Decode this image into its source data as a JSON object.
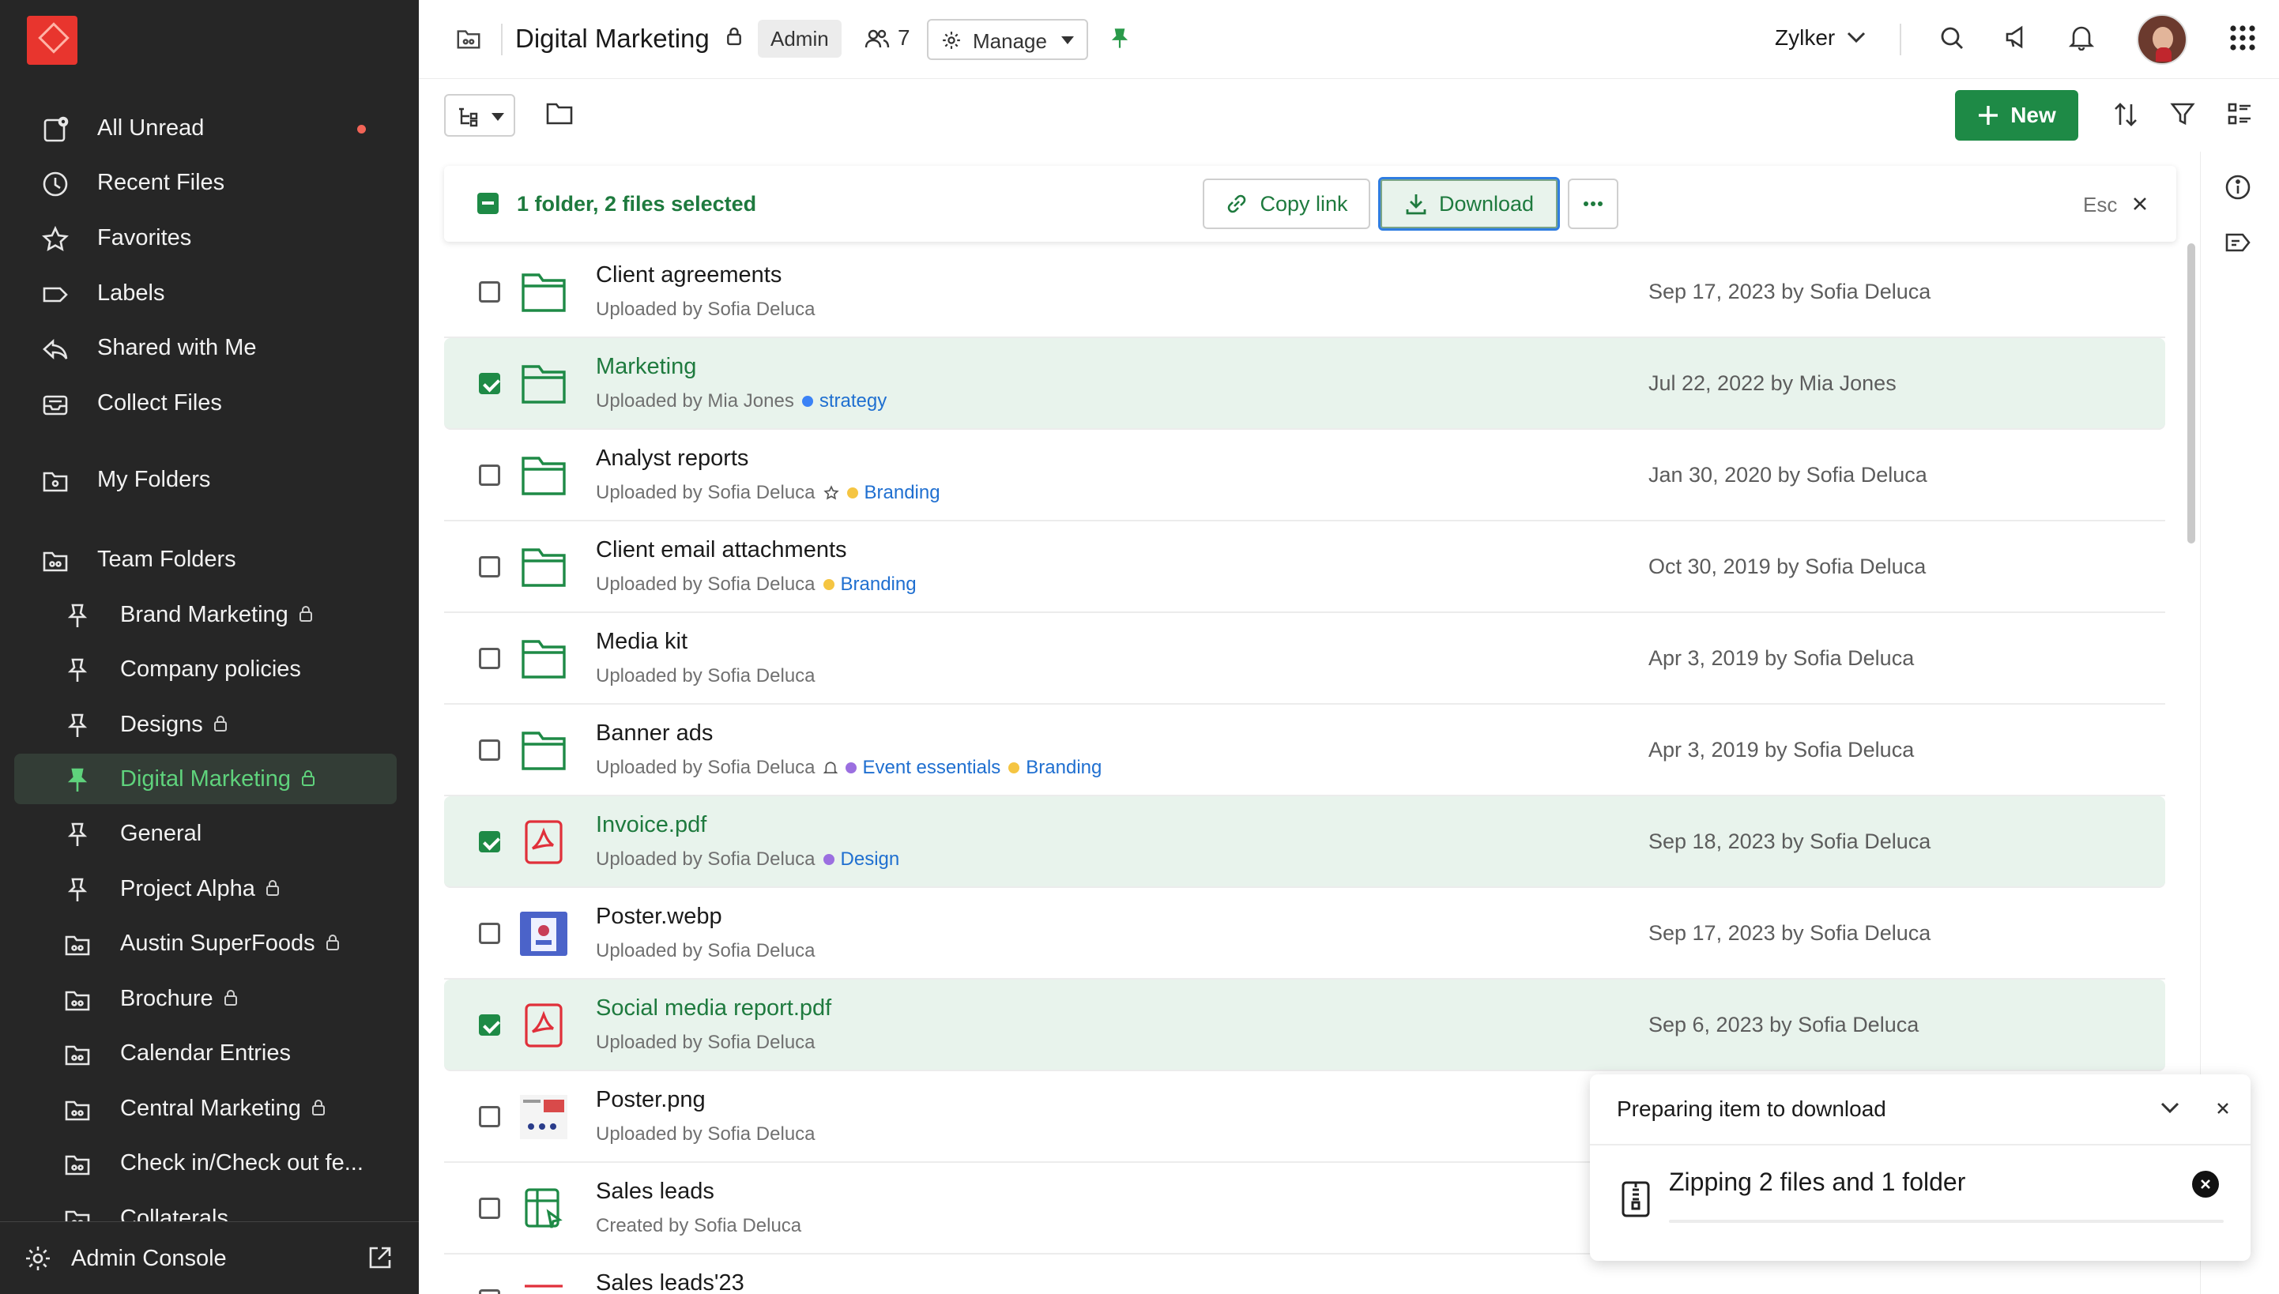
{
  "sidebar": {
    "logo_icon": "zylker-logo-icon",
    "items": [
      {
        "label": "All Unread",
        "icon": "unread-icon"
      },
      {
        "label": "Recent Files",
        "icon": "clock-icon"
      },
      {
        "label": "Favorites",
        "icon": "star-icon"
      },
      {
        "label": "Labels",
        "icon": "label-icon"
      },
      {
        "label": "Shared with Me",
        "icon": "share-icon"
      },
      {
        "label": "Collect Files",
        "icon": "inbox-icon"
      },
      {
        "label": "My Folders",
        "icon": "folder-user-icon"
      },
      {
        "label": "Team Folders",
        "icon": "team-folder-icon"
      }
    ],
    "team_folders": [
      {
        "label": "Brand Marketing",
        "icon": "pin-icon",
        "locked": true
      },
      {
        "label": "Company policies",
        "icon": "pin-icon",
        "locked": false
      },
      {
        "label": "Designs",
        "icon": "pin-icon",
        "locked": true
      },
      {
        "label": "Digital Marketing",
        "icon": "pin-icon",
        "locked": true
      },
      {
        "label": "General",
        "icon": "pin-icon",
        "locked": false
      },
      {
        "label": "Project Alpha",
        "icon": "pin-icon",
        "locked": true
      },
      {
        "label": "Austin SuperFoods",
        "icon": "team-folder-icon",
        "locked": true
      },
      {
        "label": "Brochure",
        "icon": "team-folder-icon",
        "locked": true
      },
      {
        "label": "Calendar Entries",
        "icon": "team-folder-icon",
        "locked": false
      },
      {
        "label": "Central Marketing",
        "icon": "team-folder-icon",
        "locked": true
      },
      {
        "label": "Check in/Check out fe...",
        "icon": "team-folder-icon",
        "locked": false
      },
      {
        "label": "Collaterals",
        "icon": "team-folder-icon",
        "locked": false
      }
    ],
    "footer_label": "Admin Console"
  },
  "header": {
    "title": "Digital Marketing",
    "role_badge": "Admin",
    "member_count": "7",
    "manage_label": "Manage",
    "org_name": "Zylker"
  },
  "toolbar": {
    "new_label": "New"
  },
  "selection": {
    "text": "1 folder, 2 files selected",
    "copy_link_label": "Copy link",
    "download_label": "Download",
    "esc_label": "Esc"
  },
  "files": [
    {
      "name": "Client agreements",
      "meta": "Uploaded by Sofia Deluca",
      "date": "Sep 17, 2023 by Sofia Deluca",
      "type": "folder",
      "selected": false,
      "tags": []
    },
    {
      "name": "Marketing",
      "meta": "Uploaded by Mia Jones",
      "date": "Jul 22, 2022 by Mia Jones",
      "type": "folder",
      "selected": true,
      "tags": [
        {
          "label": "strategy",
          "color": "#3b82f6"
        }
      ]
    },
    {
      "name": "Analyst reports",
      "meta": "Uploaded by Sofia Deluca",
      "date": "Jan 30, 2020 by Sofia Deluca",
      "type": "folder",
      "selected": false,
      "star": true,
      "tags": [
        {
          "label": "Branding",
          "color": "#f5c542"
        }
      ]
    },
    {
      "name": "Client email attachments",
      "meta": "Uploaded by Sofia Deluca",
      "date": "Oct 30, 2019 by Sofia Deluca",
      "type": "folder",
      "selected": false,
      "tags": [
        {
          "label": "Branding",
          "color": "#f5c542"
        }
      ]
    },
    {
      "name": "Media kit",
      "meta": "Uploaded by Sofia Deluca",
      "date": "Apr 3, 2019 by Sofia Deluca",
      "type": "folder",
      "selected": false,
      "tags": []
    },
    {
      "name": "Banner ads",
      "meta": "Uploaded by Sofia Deluca",
      "date": "Apr 3, 2019 by Sofia Deluca",
      "type": "folder",
      "selected": false,
      "bell": true,
      "tags": [
        {
          "label": "Event essentials",
          "color": "#9b6fe0"
        },
        {
          "label": "Branding",
          "color": "#f5c542"
        }
      ]
    },
    {
      "name": "Invoice.pdf",
      "meta": "Uploaded by Sofia Deluca",
      "date": "Sep 18, 2023 by Sofia Deluca",
      "type": "pdf",
      "selected": true,
      "tags": [
        {
          "label": "Design",
          "color": "#9b6fe0"
        }
      ]
    },
    {
      "name": "Poster.webp",
      "meta": "Uploaded by Sofia Deluca",
      "date": "Sep 17, 2023 by Sofia Deluca",
      "type": "image-webp",
      "selected": false,
      "tags": []
    },
    {
      "name": "Social media report.pdf",
      "meta": "Uploaded by Sofia Deluca",
      "date": "Sep 6, 2023 by Sofia Deluca",
      "type": "pdf",
      "selected": true,
      "tags": []
    },
    {
      "name": "Poster.png",
      "meta": "Uploaded by Sofia Deluca",
      "date": "",
      "type": "image-png",
      "selected": false,
      "tags": []
    },
    {
      "name": "Sales leads",
      "meta": "Created by Sofia Deluca",
      "date": "",
      "type": "sheet",
      "selected": false,
      "tags": []
    },
    {
      "name": "Sales leads'23",
      "meta": "",
      "date": "",
      "type": "presentation",
      "selected": false,
      "tags": []
    }
  ],
  "download_popup": {
    "title": "Preparing item to download",
    "status": "Zipping 2 files and 1 folder"
  },
  "colors": {
    "sidebar_bg": "#262626",
    "accent_green": "#1e8a46",
    "active_green": "#5fd27c",
    "tag_blue": "#1f6fd0",
    "pdf_red": "#e0303a"
  }
}
